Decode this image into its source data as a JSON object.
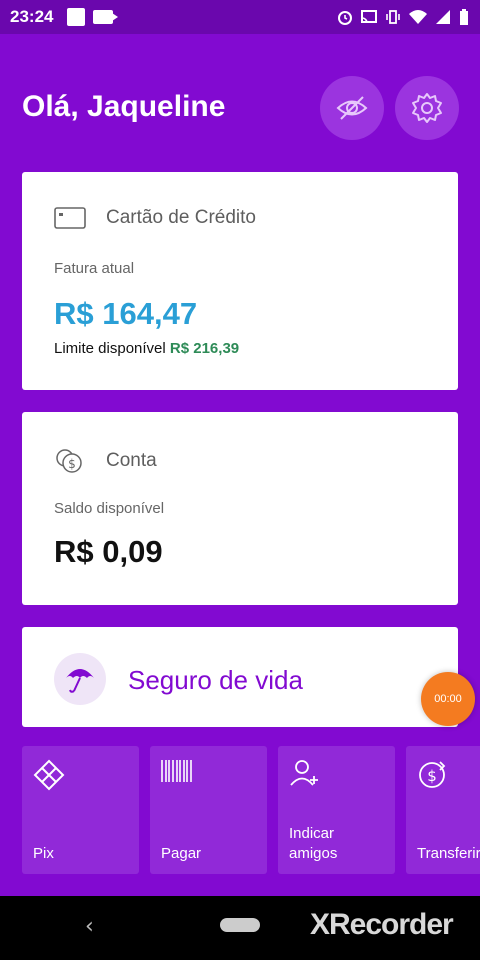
{
  "status_bar": {
    "time": "23:24",
    "icons": [
      "square-icon",
      "video-camera-icon",
      "alarm-icon",
      "cast-icon",
      "vibrate-icon",
      "wifi-icon",
      "signal-icon",
      "battery-icon"
    ]
  },
  "header": {
    "greeting": "Olá, Jaqueline",
    "buttons": [
      "hide-values-eye-icon",
      "settings-gear-icon"
    ]
  },
  "credit_card": {
    "icon": "credit-card-icon",
    "title": "Cartão de Crédito",
    "label": "Fatura atual",
    "amount": "R$ 164,47",
    "limit_label": "Limite disponível",
    "limit_value": "R$ 216,39",
    "amount_color": "#2a9fd6",
    "limit_color": "#2e8b57"
  },
  "account": {
    "icon": "coins-icon",
    "title": "Conta",
    "label": "Saldo disponível",
    "amount": "R$ 0,09"
  },
  "insurance": {
    "icon": "umbrella-icon",
    "title": "Seguro de vida"
  },
  "recorder": {
    "timer": "00:00"
  },
  "shortcuts": [
    {
      "icon": "pix-icon",
      "label": "Pix"
    },
    {
      "icon": "barcode-icon",
      "label": "Pagar"
    },
    {
      "icon": "add-friend-icon",
      "label": "Indicar\namigos"
    },
    {
      "icon": "transfer-icon",
      "label": "Transferir"
    }
  ],
  "nav": {
    "watermark": "XRecorder"
  },
  "colors": {
    "brand": "#820ad1",
    "status_bar": "#6a07ad",
    "accent_orange": "#f47b20"
  }
}
